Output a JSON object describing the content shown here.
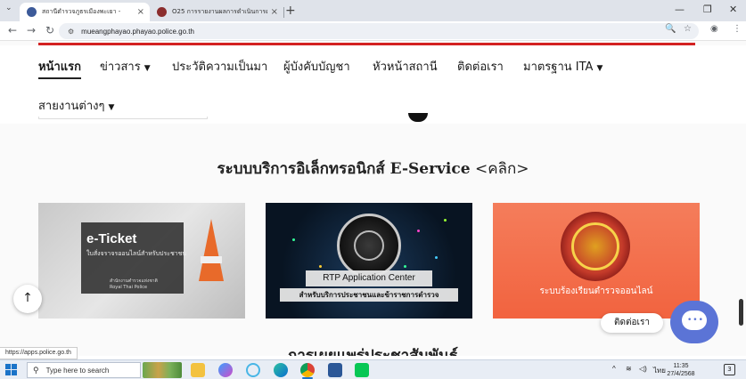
{
  "browser": {
    "tabs": [
      {
        "title": "สถานีตำรวจภูธรเมืองพะเยา -",
        "active": true,
        "favicon_color": "#3c5a99"
      },
      {
        "title": "O25 การรายงานผลการดำเนินการตา",
        "active": false,
        "favicon_color": "#8b2d2d"
      }
    ],
    "url": "mueangphayao.phayao.police.go.th",
    "status_url": "https://apps.police.go.th"
  },
  "site": {
    "accent_color": "#d32222",
    "nav": [
      {
        "label": "หน้าแรก",
        "active": true,
        "dropdown": false
      },
      {
        "label": "ข่าวสาร",
        "active": false,
        "dropdown": true
      },
      {
        "label": "ประวัติความเป็นมา",
        "active": false,
        "dropdown": false
      },
      {
        "label": "ผู้บังคับบัญชา",
        "active": false,
        "dropdown": false
      },
      {
        "label": "หัวหน้าสถานี",
        "active": false,
        "dropdown": false
      },
      {
        "label": "ติดต่อเรา",
        "active": false,
        "dropdown": false
      },
      {
        "label": "มาตรฐาน ITA",
        "active": false,
        "dropdown": true
      },
      {
        "label": "สายงานต่างๆ",
        "active": false,
        "dropdown": true
      }
    ],
    "section_title_bold": "ระบบบริการอิเล็กทรอนิกส์ E-Service",
    "section_title_link": "<คลิก>",
    "cards": [
      {
        "title": "e-Ticket",
        "subtitle": "ใบสั่งจราจรออนไลน์สำหรับประชาชน",
        "small": "สำนักงานตำรวจแห่งชาติ",
        "small_en": "Royal Thai Police"
      },
      {
        "title": "RTP Application Center",
        "subtitle": "สำหรับบริการประชาชนและข้าราชการตำรวจ"
      },
      {
        "subtitle": "ระบบร้องเรียนตำรวจออนไลน์"
      }
    ],
    "next_section_title": "การเผยแพร่ประชาสัมพันธ์",
    "contact_label": "ติดต่อเรา",
    "chat_color": "#5b74d6"
  },
  "taskbar": {
    "search_placeholder": "Type here to search",
    "language": "ไทย",
    "time": "11:35",
    "date": "27/4/2568",
    "notification_count": "3",
    "apps": [
      "file-explorer-icon",
      "copilot-icon",
      "react-icon",
      "edge-icon",
      "chrome-icon",
      "word-icon",
      "line-icon"
    ]
  }
}
